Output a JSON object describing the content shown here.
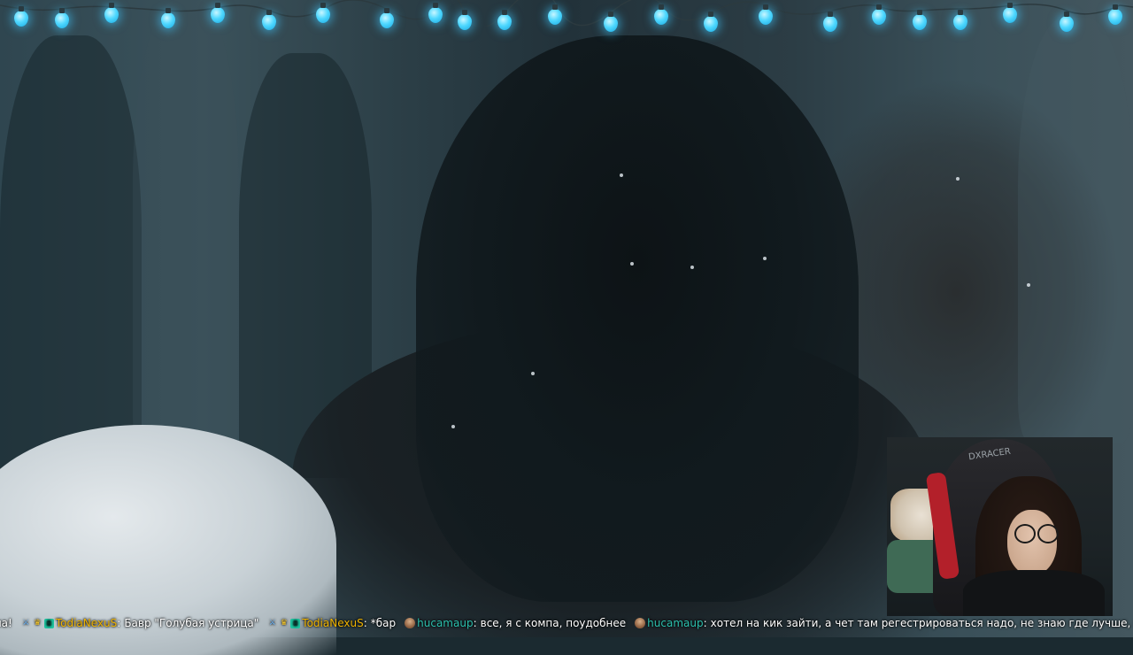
{
  "stream": {
    "scene_description": "",
    "colors": {
      "light_bulb": "#4fd8ff",
      "username_gold": "#f0b400",
      "username_teal": "#2cc1ae",
      "chat_text": "#ffffff"
    }
  },
  "webcam": {
    "chair_logo": "DXRACER"
  },
  "chat": {
    "messages": [
      {
        "id": "m0",
        "badges": [],
        "user": "",
        "text": "ла!"
      },
      {
        "id": "m1",
        "badges": [
          "sword-icon",
          "crown-icon",
          "subscriber-badge-icon"
        ],
        "user": "TodiaNexuS",
        "text": "Бавр \"Голубая устрица\""
      },
      {
        "id": "m2",
        "badges": [
          "sword-icon",
          "crown-icon",
          "subscriber-badge-icon"
        ],
        "user": "TodiaNexuS",
        "text": "*бар"
      },
      {
        "id": "m3",
        "badges": [
          "avatar-icon"
        ],
        "user": "hucamaup",
        "text": "все, я с компа, поудобнее"
      },
      {
        "id": "m4",
        "badges": [
          "avatar-icon"
        ],
        "user": "hucamaup",
        "text": "хотел на кик зайти, а чет там регестрироваться надо, не знаю где лучше, но пока тут"
      }
    ]
  }
}
